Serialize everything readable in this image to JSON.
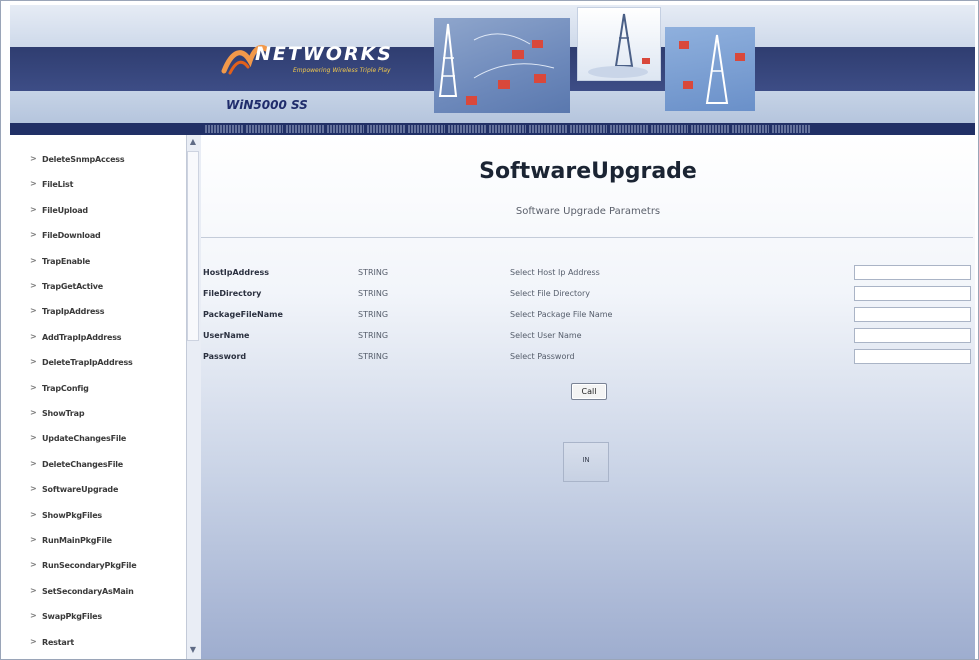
{
  "header": {
    "brand": "NETWORKS",
    "tagline": "Empowering Wireless Triple Play",
    "product": "WiN5000 SS",
    "nav_links": [
      "",
      "",
      "",
      "",
      "",
      "",
      "",
      "",
      "",
      "",
      "",
      "",
      "",
      "",
      ""
    ]
  },
  "sidebar": {
    "items": [
      {
        "label": "DeleteSnmpAccess"
      },
      {
        "label": "FileList"
      },
      {
        "label": "FileUpload"
      },
      {
        "label": "FileDownload"
      },
      {
        "label": "TrapEnable"
      },
      {
        "label": "TrapGetActive"
      },
      {
        "label": "TrapIpAddress"
      },
      {
        "label": "AddTrapIpAddress"
      },
      {
        "label": "DeleteTrapIpAddress"
      },
      {
        "label": "TrapConfig"
      },
      {
        "label": "ShowTrap"
      },
      {
        "label": "UpdateChangesFile"
      },
      {
        "label": "DeleteChangesFile"
      },
      {
        "label": "SoftwareUpgrade"
      },
      {
        "label": "ShowPkgFiles"
      },
      {
        "label": "RunMainPkgFile"
      },
      {
        "label": "RunSecondaryPkgFile"
      },
      {
        "label": "SetSecondaryAsMain"
      },
      {
        "label": "SwapPkgFiles"
      },
      {
        "label": "Restart"
      }
    ],
    "arrow_glyph": ">"
  },
  "main": {
    "title": "SoftwareUpgrade",
    "subtitle": "Software Upgrade Parametrs",
    "params": [
      {
        "name": "HostIpAddress",
        "type": "STRING",
        "desc": "Select Host Ip Address",
        "value": ""
      },
      {
        "name": "FileDirectory",
        "type": "STRING",
        "desc": "Select File Directory",
        "value": ""
      },
      {
        "name": "PackageFileName",
        "type": "STRING",
        "desc": "Select Package File Name",
        "value": ""
      },
      {
        "name": "UserName",
        "type": "STRING",
        "desc": "Select User Name",
        "value": ""
      },
      {
        "name": "Password",
        "type": "STRING",
        "desc": "Select Password",
        "value": ""
      }
    ],
    "call_label": "Call",
    "result_text": "IN"
  },
  "colors": {
    "header_dark": "#2f3d70",
    "nav_bar": "#213066",
    "logo_accent": "#f2994a",
    "title_text": "#1b2433"
  }
}
